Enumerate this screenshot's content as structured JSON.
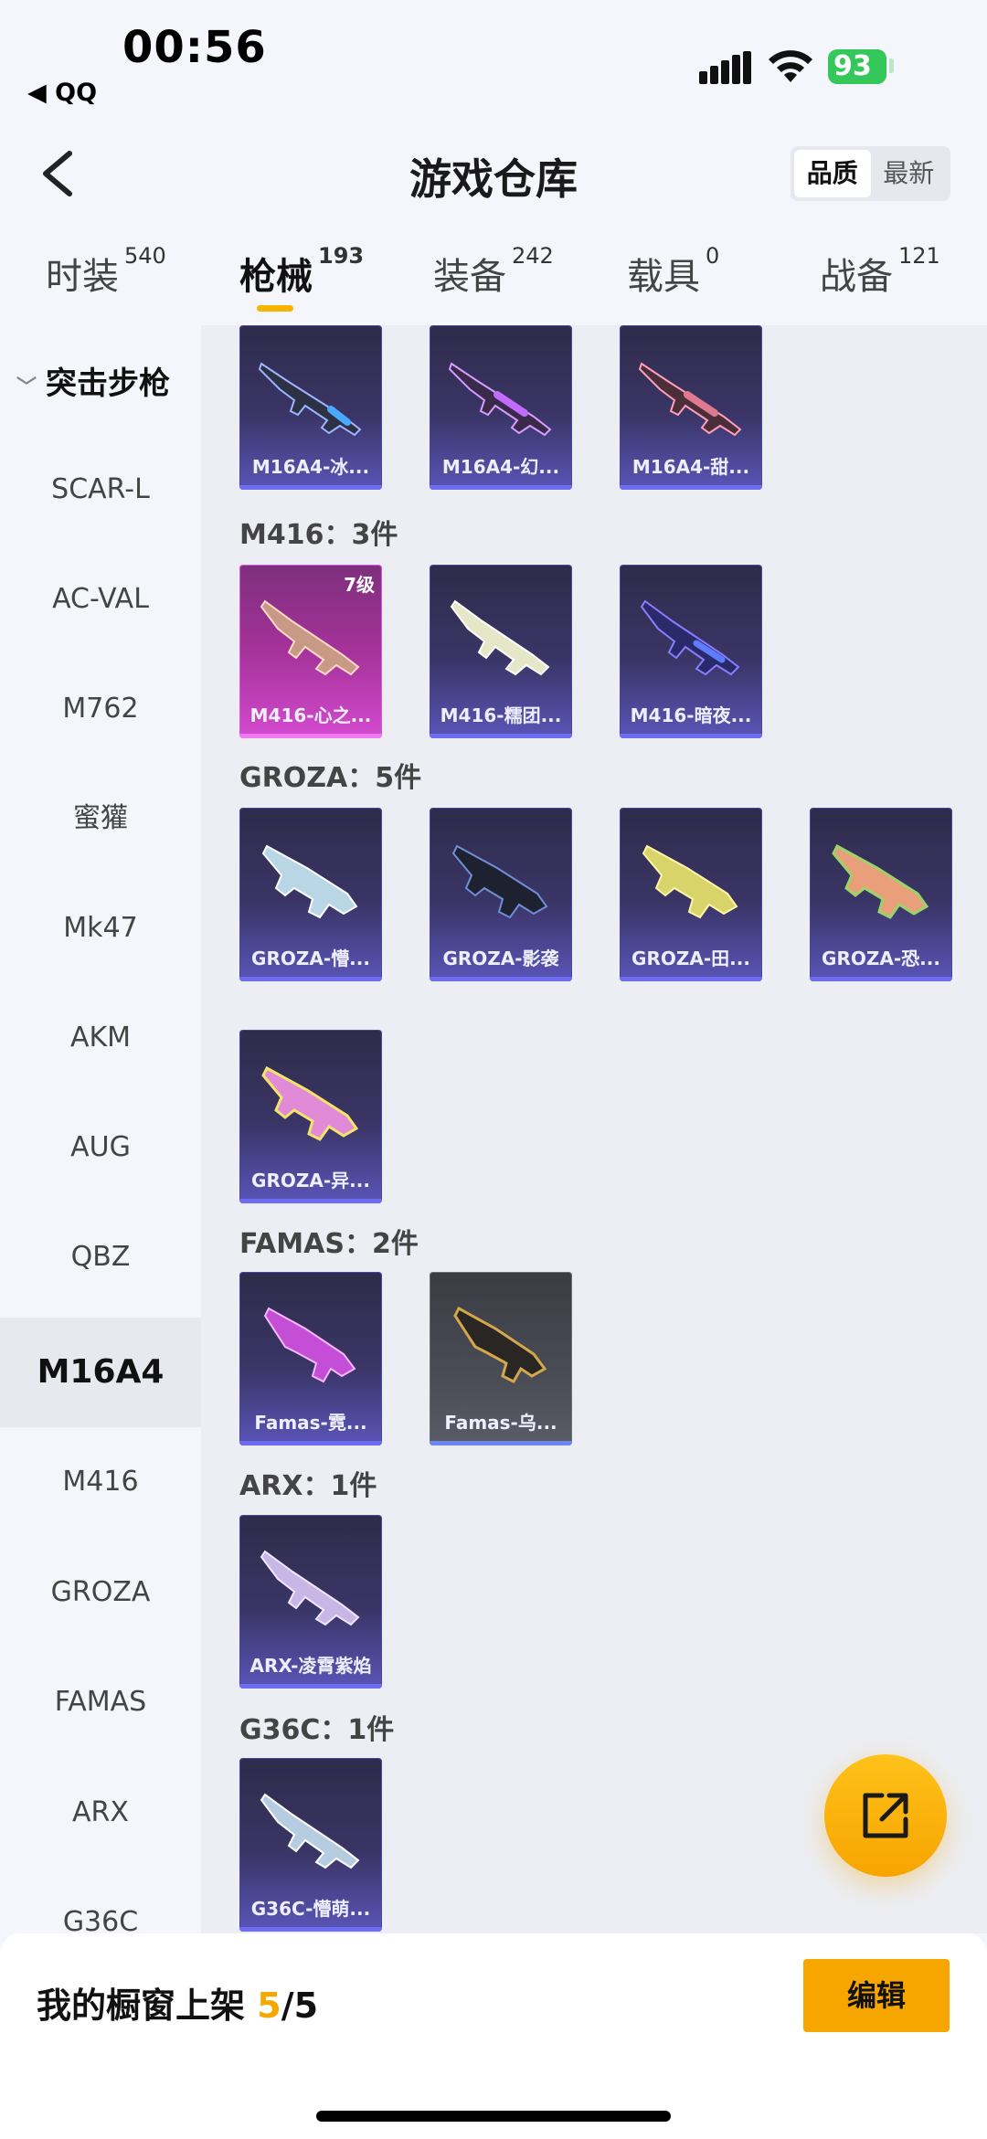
{
  "status": {
    "time": "00:56",
    "back_app": "◀ QQ",
    "battery": "93"
  },
  "header": {
    "title": "游戏仓库",
    "sort_options": [
      "品质",
      "最新"
    ]
  },
  "tabs": [
    {
      "label": "时装",
      "count": "540"
    },
    {
      "label": "枪械",
      "count": "193"
    },
    {
      "label": "装备",
      "count": "242"
    },
    {
      "label": "载具",
      "count": "0"
    },
    {
      "label": "战备",
      "count": "121"
    }
  ],
  "sidebar": {
    "group": "突击步枪",
    "items": [
      "SCAR-L",
      "AC-VAL",
      "M762",
      "蜜獾",
      "Mk47",
      "AKM",
      "AUG",
      "QBZ",
      "M16A4",
      "M416",
      "GROZA",
      "FAMAS",
      "ARX",
      "G36C"
    ]
  },
  "sections": {
    "m16": {
      "items": [
        "M16A4-冰...",
        "M16A4-幻...",
        "M16A4-甜..."
      ]
    },
    "m416": {
      "title": "M416：3件",
      "items": [
        "M416-心之...",
        "M416-糯团...",
        "M416-暗夜..."
      ],
      "level": "7级"
    },
    "groza": {
      "title": "GROZA：5件",
      "items": [
        "GROZA-懵...",
        "GROZA-影袭",
        "GROZA-田...",
        "GROZA-恐...",
        "GROZA-异..."
      ]
    },
    "famas": {
      "title": "FAMAS：2件",
      "items": [
        "Famas-霓...",
        "Famas-乌..."
      ]
    },
    "arx": {
      "title": "ARX：1件",
      "items": [
        "ARX-凌霄紫焰"
      ]
    },
    "g36c": {
      "title": "G36C：1件",
      "items": [
        "G36C-懵萌..."
      ]
    }
  },
  "bottom": {
    "label": "我的橱窗上架 ",
    "shelf_count": "5",
    "shelf_total": "/5",
    "edit_label": "编辑"
  },
  "colors": {
    "accent": "#f7a600",
    "card_purple": "#3a3566",
    "card_pink": "#a5329a"
  }
}
